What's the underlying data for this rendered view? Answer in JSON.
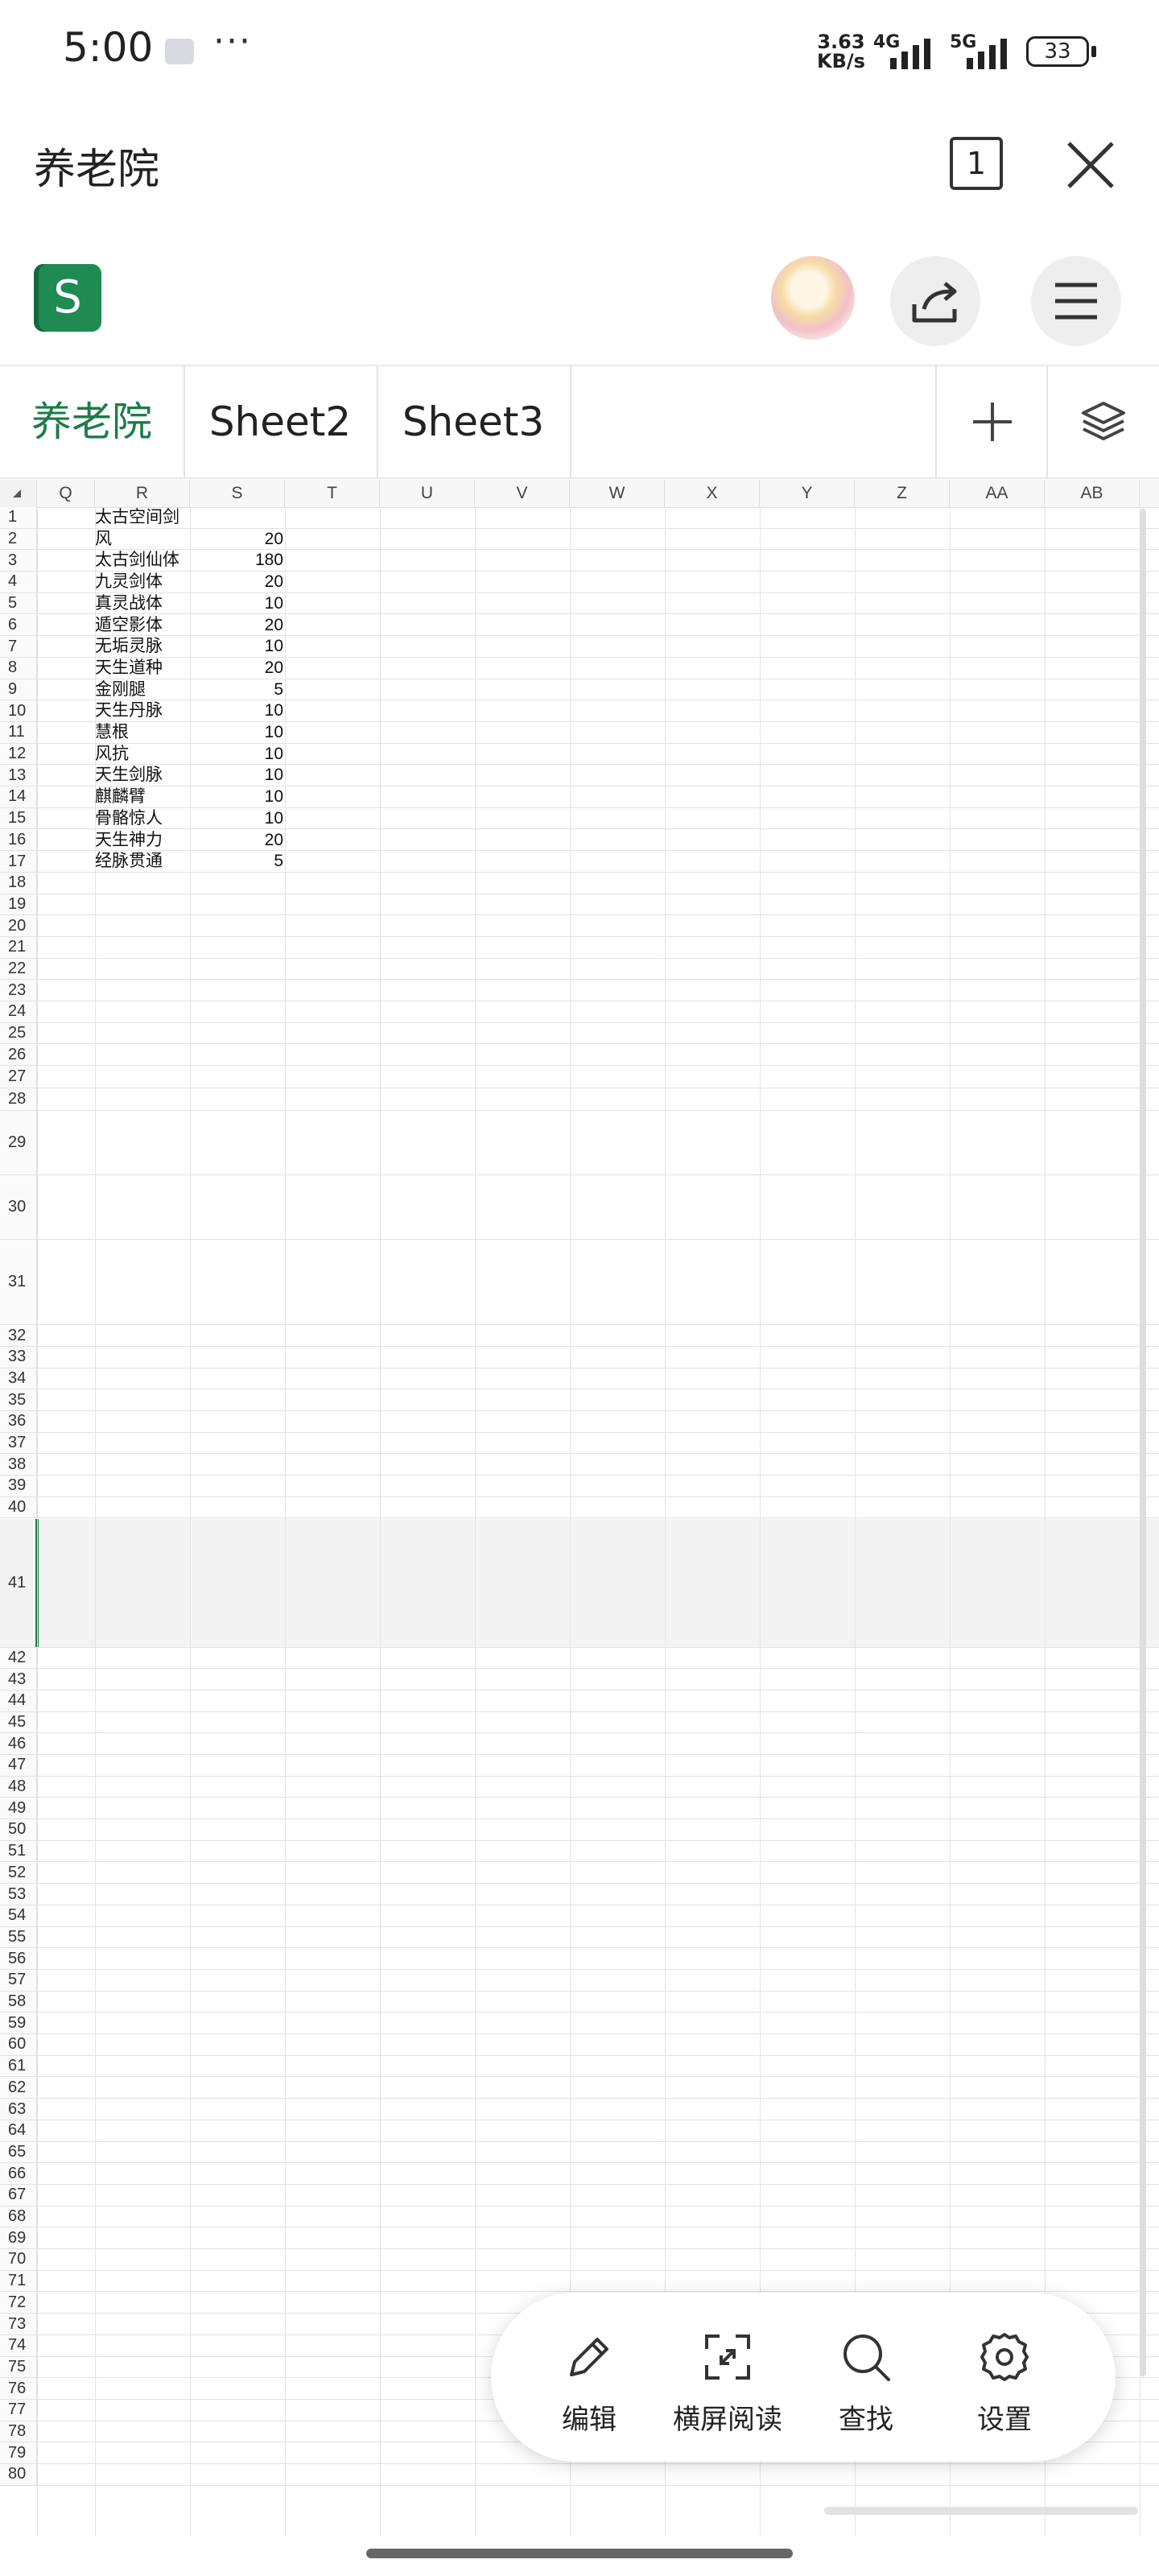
{
  "status_bar": {
    "time": "5:00",
    "more": "···",
    "net_speed_value": "3.63",
    "net_speed_unit": "KB/s",
    "network_1": "4G",
    "network_2": "5G",
    "battery": "33"
  },
  "header": {
    "title": "养老院",
    "tab_count": "1"
  },
  "app": {
    "icon_letter": "S"
  },
  "sheet_tabs": [
    {
      "label": "养老院",
      "active": true
    },
    {
      "label": "Sheet2",
      "active": false
    },
    {
      "label": "Sheet3",
      "active": false
    }
  ],
  "grid": {
    "columns": [
      "Q",
      "R",
      "S",
      "T",
      "U",
      "V",
      "W",
      "X",
      "Y",
      "Z",
      "AA",
      "AB"
    ],
    "rows": [
      {
        "n": "1",
        "r": "太古空间剑",
        "s": ""
      },
      {
        "n": "2",
        "r": "风",
        "s": "20"
      },
      {
        "n": "3",
        "r": "太古剑仙体",
        "s": "180"
      },
      {
        "n": "4",
        "r": "九灵剑体",
        "s": "20"
      },
      {
        "n": "5",
        "r": "真灵战体",
        "s": "10"
      },
      {
        "n": "6",
        "r": "遁空影体",
        "s": "20"
      },
      {
        "n": "7",
        "r": "无垢灵脉",
        "s": "10"
      },
      {
        "n": "8",
        "r": "天生道种",
        "s": "20"
      },
      {
        "n": "9",
        "r": "金刚腿",
        "s": "5"
      },
      {
        "n": "10",
        "r": "天生丹脉",
        "s": "10"
      },
      {
        "n": "11",
        "r": "慧根",
        "s": "10"
      },
      {
        "n": "12",
        "r": "风抗",
        "s": "10"
      },
      {
        "n": "13",
        "r": "天生剑脉",
        "s": "10"
      },
      {
        "n": "14",
        "r": "麒麟臂",
        "s": "10"
      },
      {
        "n": "15",
        "r": "骨骼惊人",
        "s": "10"
      },
      {
        "n": "16",
        "r": "天生神力",
        "s": "20"
      },
      {
        "n": "17",
        "r": "经脉贯通",
        "s": "5"
      }
    ],
    "empty_rows_to": 80,
    "selected_row": "41"
  },
  "toolbar": {
    "edit": "编辑",
    "landscape": "横屏阅读",
    "find": "查找",
    "settings": "设置"
  },
  "icons": {
    "close": "close-icon",
    "share": "share-icon",
    "menu": "menu-icon",
    "add": "plus-icon",
    "layers": "layers-icon",
    "edit": "pencil-icon",
    "landscape": "expand-icon",
    "find": "search-icon",
    "settings": "gear-icon"
  },
  "colors": {
    "accent": "#1c7c4a",
    "app_icon": "#1f8a52"
  }
}
